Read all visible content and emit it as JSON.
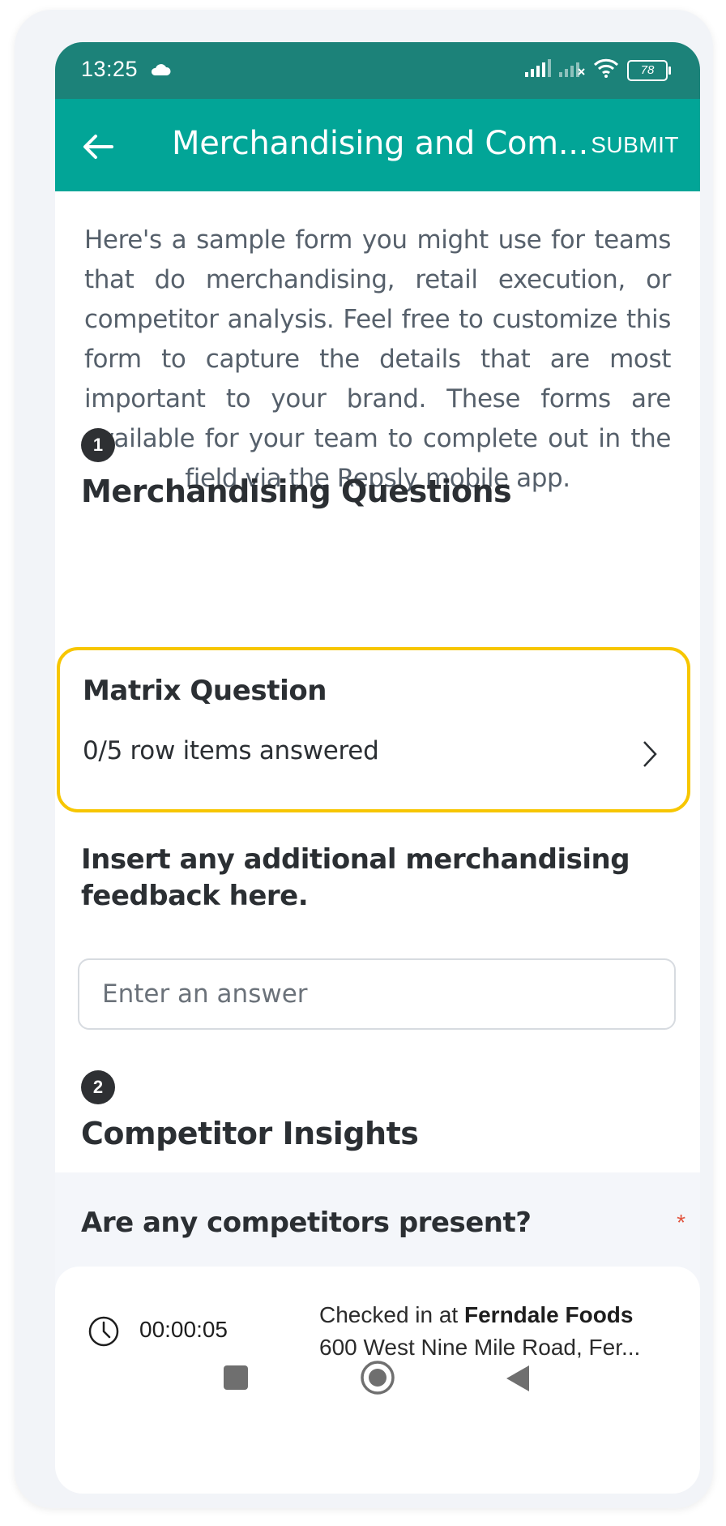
{
  "status_bar": {
    "time": "13:25",
    "battery": "78"
  },
  "app_bar": {
    "title": "Merchandising and Com...",
    "submit_label": "SUBMIT"
  },
  "form": {
    "intro": "Here's a sample form you might use for teams that do merchandising, retail execution, or competitor analysis. Feel free to customize this form to capture the details that are most important to your brand. These forms are available for your team to complete out in the field via the Repsly mobile app.",
    "sections": [
      {
        "number": "1",
        "title": "Merchandising Questions"
      },
      {
        "number": "2",
        "title": "Competitor Insights"
      }
    ],
    "matrix_question": {
      "title": "Matrix Question",
      "progress": "0/5 row items answered"
    },
    "feedback_question": {
      "label": "Insert any additional merchandising feedback here.",
      "placeholder": "Enter an answer"
    },
    "competitor_question": {
      "label": "Are any competitors present?",
      "required_mark": "*"
    }
  },
  "check_in": {
    "timer": "00:00:05",
    "prefix": "Checked in at",
    "store": "Ferndale Foods",
    "address": "600 West Nine Mile Road, Fer..."
  },
  "colors": {
    "status_bar": "#1c8279",
    "app_bar": "#02a597",
    "highlight_border": "#f7c600",
    "required": "#e2553f"
  }
}
